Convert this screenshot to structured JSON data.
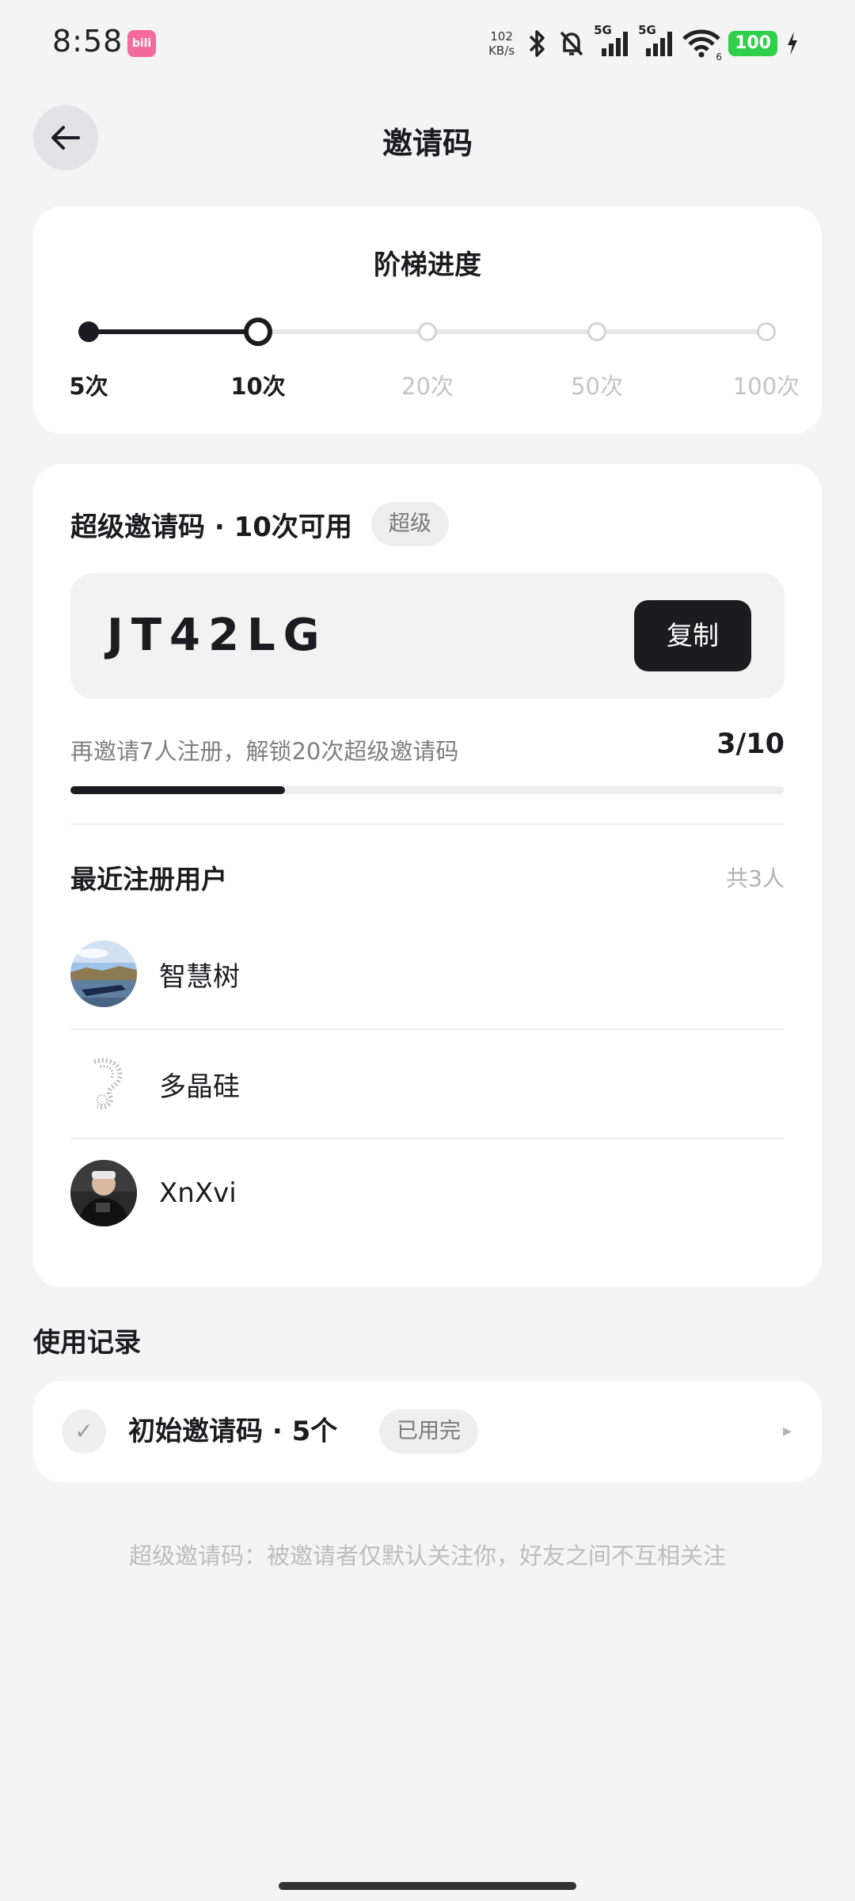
{
  "status_bar": {
    "time": "8:58",
    "app_icon_text": "bili",
    "net_speed_value": "102",
    "net_speed_unit": "KB/s",
    "signal_1_label": "5G",
    "signal_2_label": "5G",
    "wifi_sub": "6",
    "battery": "100",
    "icons": [
      "bluetooth-icon",
      "bell-off-icon",
      "signal-icon",
      "wifi-icon",
      "battery-icon",
      "charging-icon"
    ]
  },
  "header": {
    "title": "邀请码",
    "back_icon": "arrow-left-icon"
  },
  "ladder": {
    "title": "阶梯进度",
    "current_index": 1,
    "steps": [
      {
        "label": "5次",
        "state": "done"
      },
      {
        "label": "10次",
        "state": "current"
      },
      {
        "label": "20次",
        "state": "pending"
      },
      {
        "label": "50次",
        "state": "pending"
      },
      {
        "label": "100次",
        "state": "pending"
      }
    ]
  },
  "invite": {
    "title": "超级邀请码 · 10次可用",
    "tag": "超级",
    "code": "JT42LG",
    "copy_label": "复制",
    "unlock_hint": "再邀请7人注册，解锁20次超级邀请码",
    "progress_text": "3/10",
    "progress_value": 0.3
  },
  "recent_users": {
    "title": "最近注册用户",
    "count_label": "共3人",
    "users": [
      {
        "name": "智慧树"
      },
      {
        "name": "多晶硅"
      },
      {
        "name": "XnXvi"
      }
    ]
  },
  "records": {
    "title": "使用记录",
    "items": [
      {
        "check": "✓",
        "label": "初始邀请码 · 5个",
        "tag": "已用完",
        "arrow": "▸"
      }
    ]
  },
  "footer_note": "超级邀请码：被邀请者仅默认关注你，好友之间不互相关注",
  "colors": {
    "accent": "#1c1c20",
    "background": "#f4f4f4",
    "card": "#ffffff",
    "muted": "#808080",
    "battery": "#2fcf4a"
  }
}
